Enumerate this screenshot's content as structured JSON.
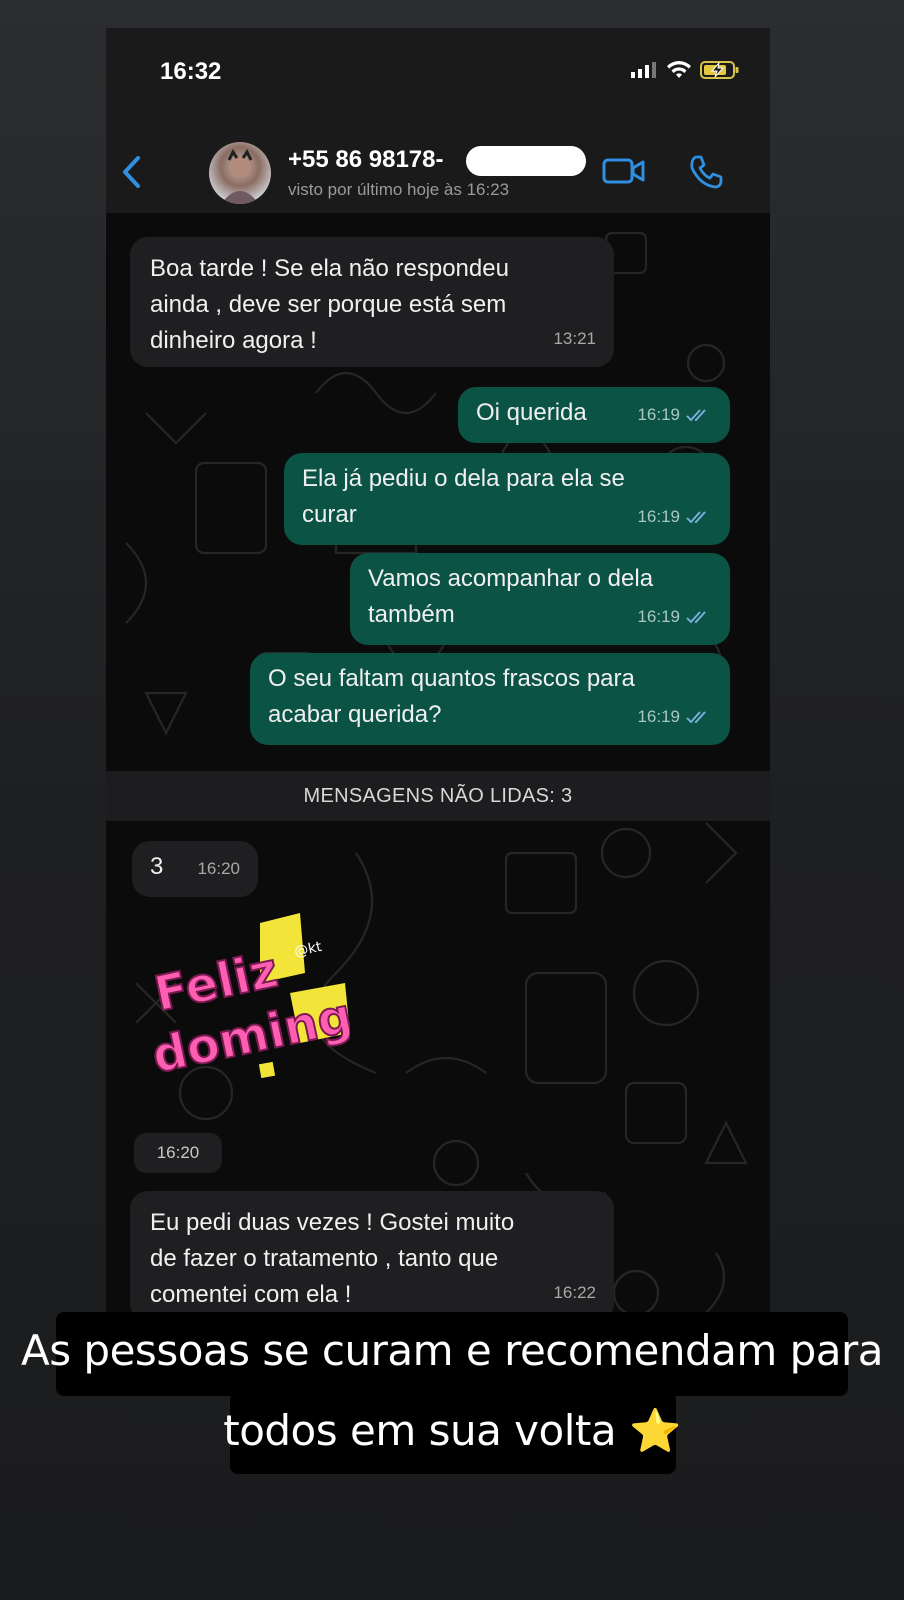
{
  "status_bar": {
    "time": "16:32"
  },
  "header": {
    "contact_name": "+55 86 98178-",
    "last_seen": "visto por último hoje às 16:23",
    "icons": [
      "back-chevron-icon",
      "video-call-icon",
      "phone-call-icon"
    ]
  },
  "messages": [
    {
      "dir": "in",
      "text": "Boa tarde ! Se ela não respondeu\nainda , deve ser porque está sem\ndinheiro agora !",
      "time": "13:21"
    },
    {
      "dir": "out",
      "text": "Oi querida",
      "time": "16:19"
    },
    {
      "dir": "out",
      "text": "Ela já pediu o dela para ela se\ncurar",
      "time": "16:19"
    },
    {
      "dir": "out",
      "text": "Vamos acompanhar o dela\ntambém",
      "time": "16:19"
    },
    {
      "dir": "out",
      "text": "O seu faltam quantos frascos para\nacabar querida?",
      "time": "16:19"
    }
  ],
  "unread_label": "MENSAGENS NÃO LIDAS: 3",
  "messages_after": [
    {
      "dir": "in",
      "text": "3",
      "time": "16:20"
    },
    {
      "dir": "in",
      "type": "sticker",
      "sticker_text": [
        "Feliz",
        "domingo"
      ],
      "sticker_tag": "@kt",
      "time": "16:20"
    },
    {
      "dir": "in",
      "text": "Eu pedi duas vezes ! Gostei muito\nde fazer o tratamento , tanto que\ncomentei com ela !",
      "time": "16:22"
    }
  ],
  "caption": {
    "line1": "As pessoas se curam e recomendam para",
    "line2": "todos em sua volta ⭐"
  },
  "colors": {
    "outgoing_bubble": "#0b5445",
    "incoming_bubble": "#1f1f21",
    "accent_blue": "#2f8fe0",
    "read_ticks": "#7fb3e6"
  }
}
